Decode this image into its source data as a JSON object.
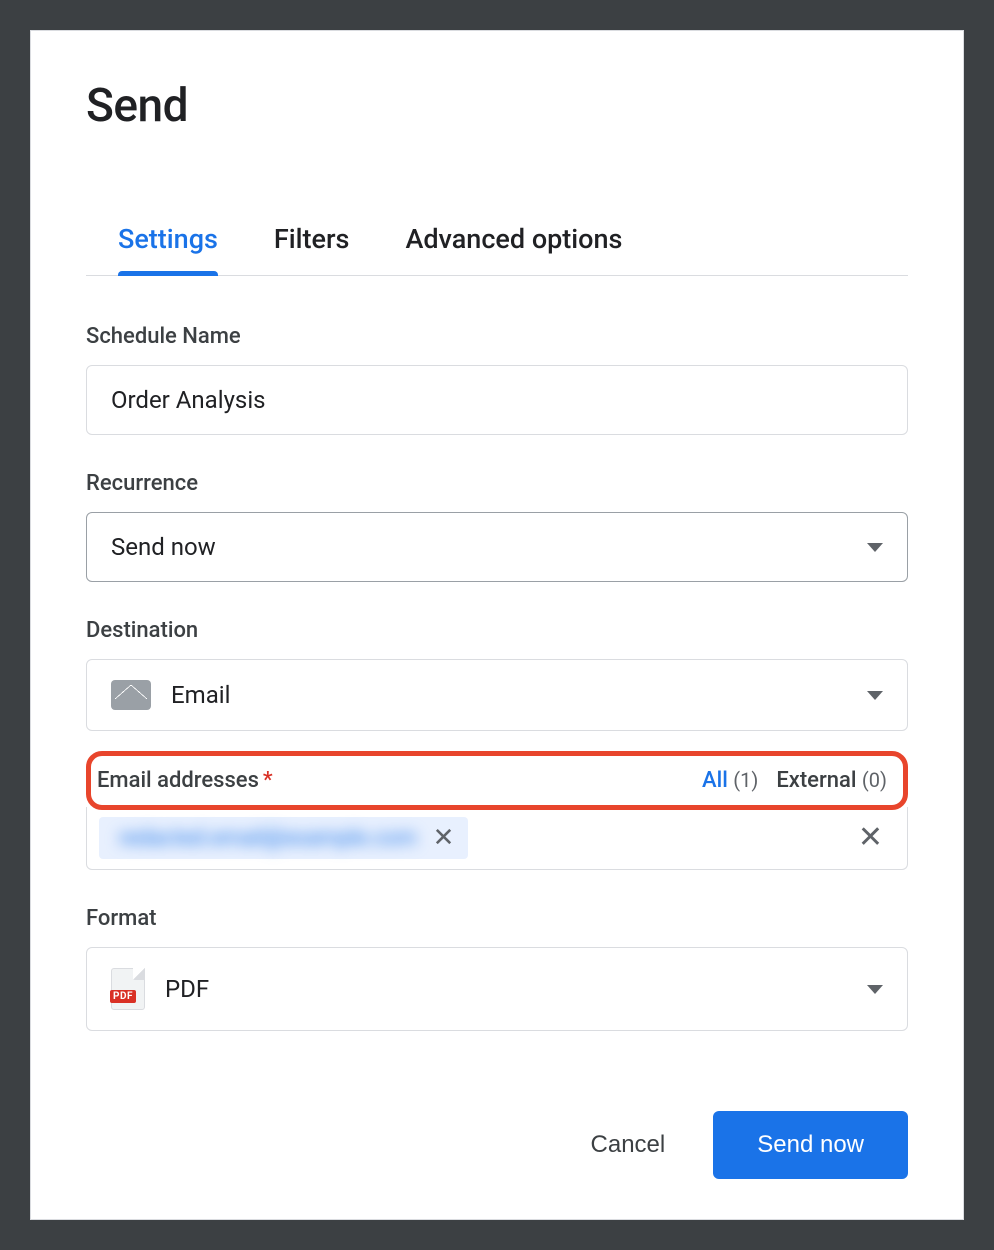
{
  "title": "Send",
  "tabs": [
    {
      "label": "Settings",
      "active": true
    },
    {
      "label": "Filters",
      "active": false
    },
    {
      "label": "Advanced options",
      "active": false
    }
  ],
  "scheduleName": {
    "label": "Schedule Name",
    "value": "Order Analysis"
  },
  "recurrence": {
    "label": "Recurrence",
    "value": "Send now"
  },
  "destination": {
    "label": "Destination",
    "value": "Email",
    "icon": "mail-icon"
  },
  "emailAddresses": {
    "label": "Email addresses",
    "required": true,
    "filters": {
      "all": {
        "label": "All",
        "count": 1
      },
      "external": {
        "label": "External",
        "count": 0
      }
    },
    "chips": [
      {
        "text": "redacted.email@example.com"
      }
    ]
  },
  "format": {
    "label": "Format",
    "value": "PDF",
    "icon": "pdf-icon"
  },
  "footer": {
    "cancel": "Cancel",
    "submit": "Send now"
  }
}
